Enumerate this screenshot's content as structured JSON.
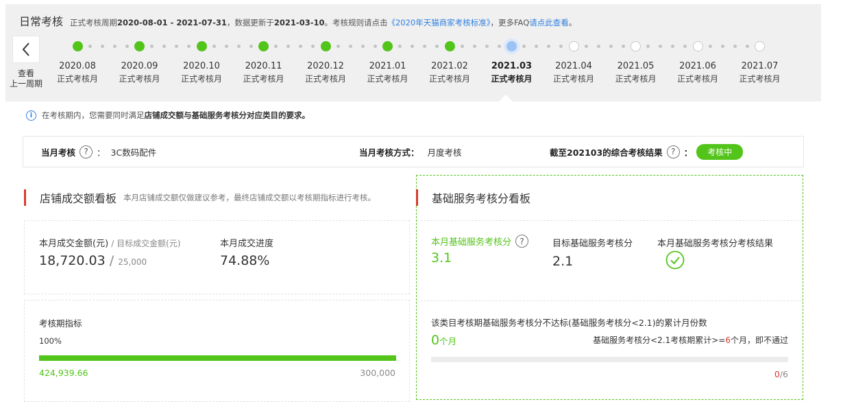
{
  "header": {
    "title": "日常考核",
    "period_prefix": "正式考核周期",
    "period": "2020-08-01 - 2021-07-31",
    "update_prefix": "，数据更新于",
    "update_date": "2021-03-10",
    "rule_prefix": "。考核规则请点击",
    "rule_link": "《2020年天猫商家考核标准》",
    "faq_prefix": "，更多FAQ",
    "faq_link": "请点此查看",
    "faq_suffix": "。"
  },
  "prev_button": {
    "line1": "查看",
    "line2": "上一周期"
  },
  "timeline": [
    {
      "date": "2020.08",
      "label": "正式考核月",
      "status": "done"
    },
    {
      "date": "2020.09",
      "label": "正式考核月",
      "status": "done"
    },
    {
      "date": "2020.10",
      "label": "正式考核月",
      "status": "done"
    },
    {
      "date": "2020.11",
      "label": "正式考核月",
      "status": "done"
    },
    {
      "date": "2020.12",
      "label": "正式考核月",
      "status": "done"
    },
    {
      "date": "2021.01",
      "label": "正式考核月",
      "status": "done"
    },
    {
      "date": "2021.02",
      "label": "正式考核月",
      "status": "done"
    },
    {
      "date": "2021.03",
      "label": "正式考核月",
      "status": "current"
    },
    {
      "date": "2021.04",
      "label": "正式考核月",
      "status": "future"
    },
    {
      "date": "2021.05",
      "label": "正式考核月",
      "status": "future"
    },
    {
      "date": "2021.06",
      "label": "正式考核月",
      "status": "future"
    },
    {
      "date": "2021.07",
      "label": "正式考核月",
      "status": "future"
    }
  ],
  "notice": {
    "prefix": "在考核期内，您需要同时满足",
    "bold": "店铺成交额与基础服务考核分对应类目的要求。"
  },
  "summary": {
    "monthly_label": "当月考核",
    "colon": "：",
    "category": "3C数码配件",
    "method_label": "当月考核方式：",
    "method_value": "月度考核",
    "result_label": "截至202103的综合考核结果",
    "result_badge": "考核中"
  },
  "store_panel": {
    "title": "店铺成交额看板",
    "note": "本月店铺成交额仅做建议参考，最终店铺成交额以考核期指标进行考核。",
    "amount_label": "本月成交金额(元)",
    "target_label": "/ 目标成交金额(元)",
    "amount_value": "18,720.03",
    "target_value": "25,000",
    "progress_label": "本月成交进度",
    "progress_value": "74.88%",
    "period_label": "考核期指标",
    "period_percent": "100%",
    "period_progress": 1.0,
    "period_actual": "424,939.66",
    "period_target": "300,000"
  },
  "service_panel": {
    "title": "基础服务考核分看板",
    "score_label": "本月基础服务考核分",
    "score_value": "3.1",
    "target_label": "目标基础服务考核分",
    "target_value": "2.1",
    "result_label": "本月基础服务考核分考核结果",
    "fail_desc": "该类目考核期基础服务考核分不达标(基础服务考核分<2.1)的累计月份数",
    "fail_count": "0",
    "fail_unit": "个月",
    "rule_prefix": "基础服务考核分<2.1考核期累计>=",
    "rule_limit": "6",
    "rule_suffix": "个月，即不通过",
    "fail_progress": 0,
    "counter_current": "0",
    "counter_total": "/6"
  },
  "colors": {
    "green": "#52c41a",
    "red": "#d83a2e",
    "blue_link": "#2f7fe0",
    "current_node": "#9cc3f5"
  },
  "icons": {
    "prev": "chevron-left-icon",
    "info": "info-icon",
    "help": "question-circle-icon",
    "check": "check-circle-icon"
  }
}
